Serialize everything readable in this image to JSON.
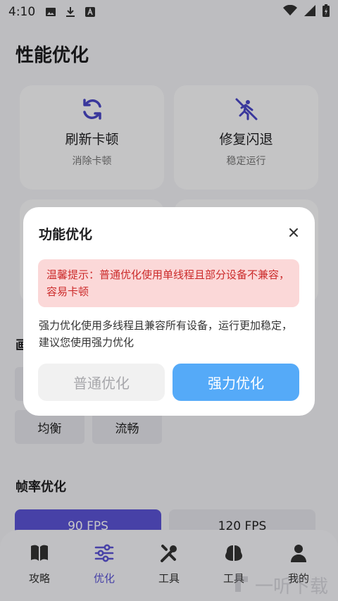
{
  "status_bar": {
    "time": "4:10"
  },
  "page_title": "性能优化",
  "cards": [
    {
      "title": "刷新卡顿",
      "subtitle": "消除卡顿",
      "icon": "refresh-icon"
    },
    {
      "title": "修复闪退",
      "subtitle": "稳定运行",
      "icon": "run-slash-icon"
    }
  ],
  "section_graphics": {
    "title_fragment": "画"
  },
  "quality_chips": [
    "均衡",
    "流畅"
  ],
  "section_fps": {
    "title": "帧率优化"
  },
  "fps_options": [
    {
      "label": "90 FPS",
      "selected": true
    },
    {
      "label": "120 FPS",
      "selected": false
    }
  ],
  "bottom_nav": [
    {
      "label": "攻略",
      "icon": "book-icon",
      "active": false
    },
    {
      "label": "优化",
      "icon": "sliders-icon",
      "active": true
    },
    {
      "label": "工具",
      "icon": "tools-icon",
      "active": false
    },
    {
      "label": "工具",
      "icon": "brain-icon",
      "active": false
    },
    {
      "label": "我的",
      "icon": "user-icon",
      "active": false
    }
  ],
  "dialog": {
    "title": "功能优化",
    "warning": "温馨提示：普通优化使用单线程且部分设备不兼容，容易卡顿",
    "description": "强力优化使用多线程且兼容所有设备，运行更加稳定，建议您使用强力优化",
    "normal_button": "普通优化",
    "strong_button": "强力优化"
  },
  "watermark": "一听下载",
  "colors": {
    "accent": "#5b54d6",
    "primary_button": "#55aaf8",
    "warning_bg": "#fbd8d8",
    "warning_text": "#cc2b2b"
  }
}
